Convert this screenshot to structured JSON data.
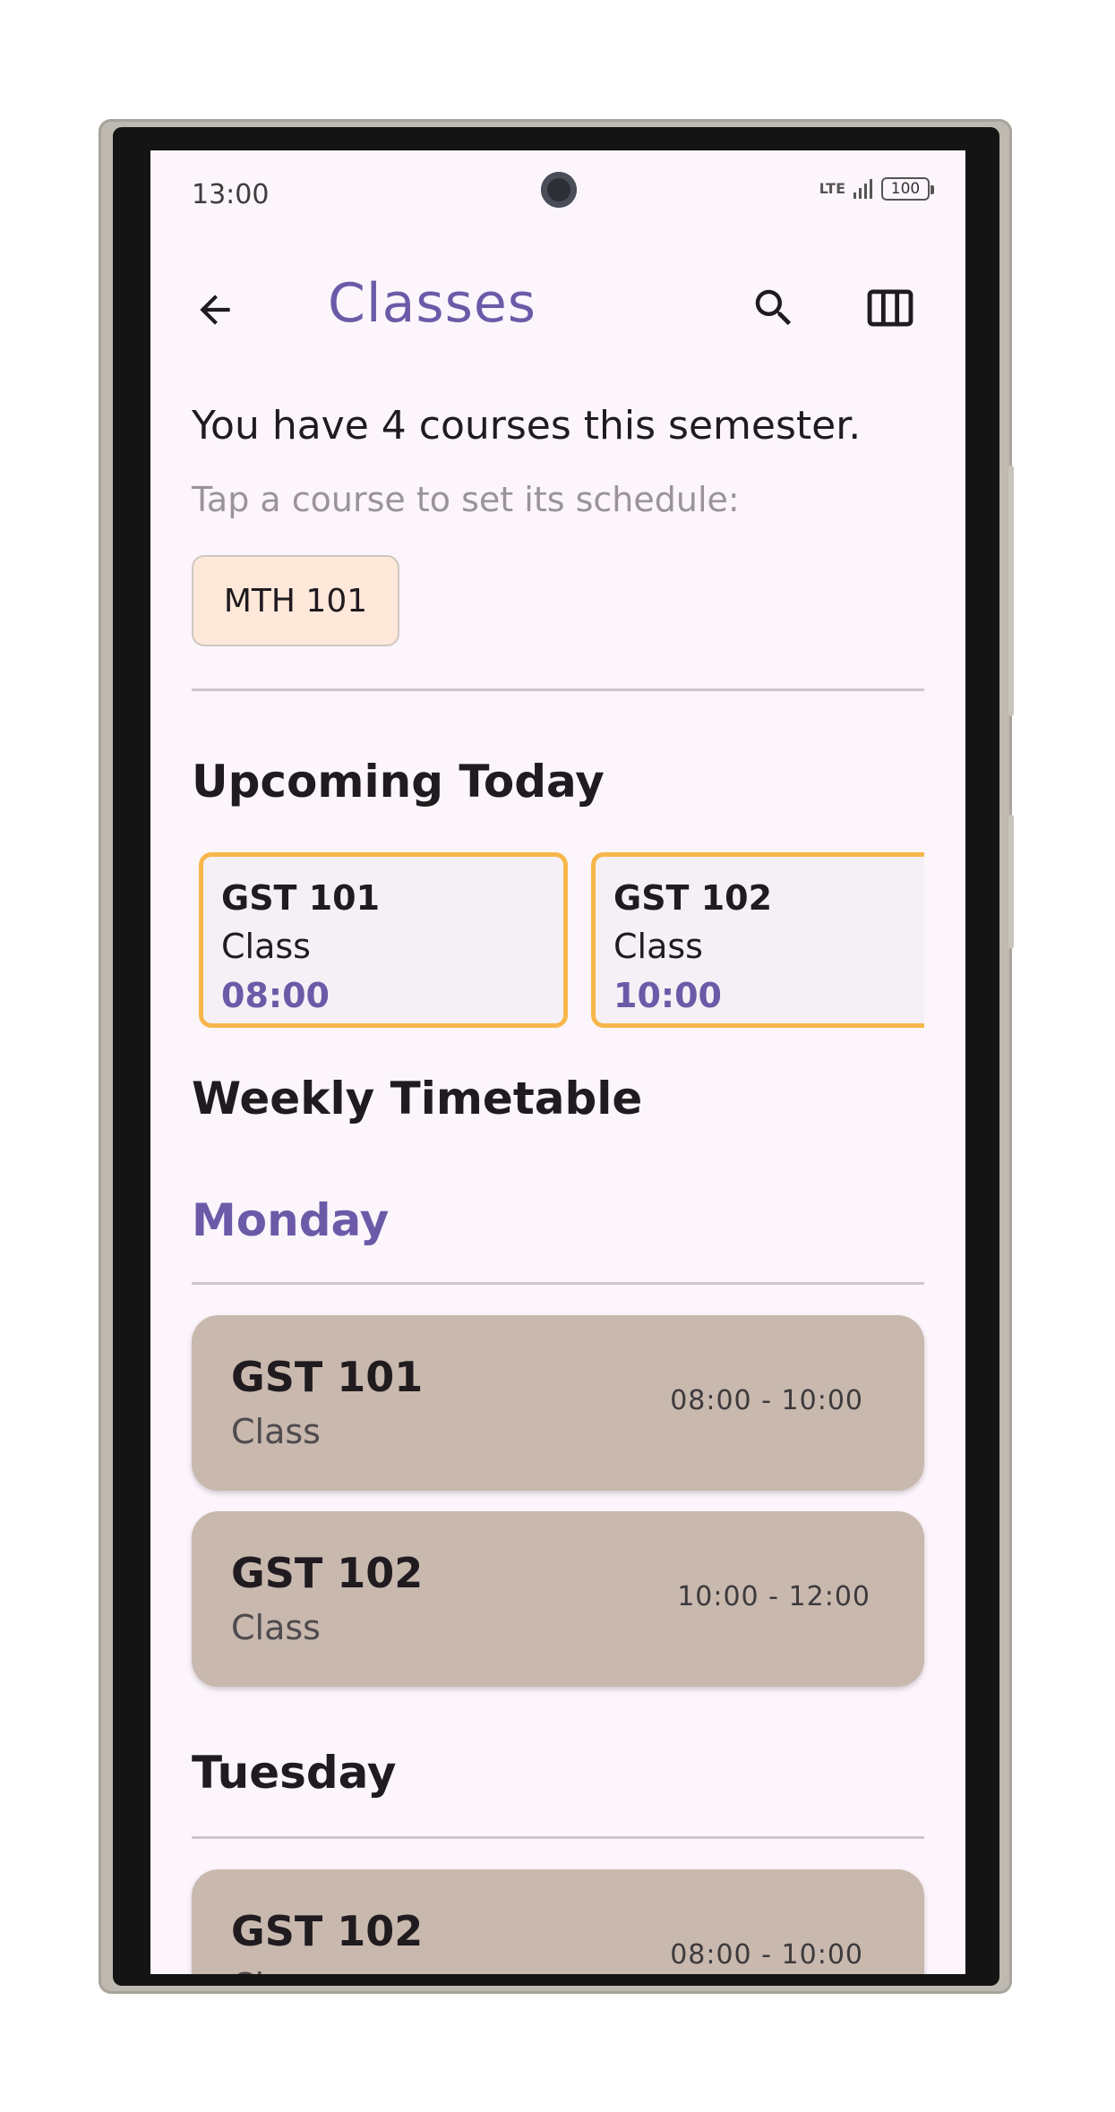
{
  "status_bar": {
    "time": "13:00",
    "network": "LTE",
    "battery": "100"
  },
  "app_bar": {
    "title": "Classes",
    "icons": [
      "back-arrow-icon",
      "search-icon",
      "view-columns-icon"
    ]
  },
  "summary": "You have 4 courses this semester.",
  "hint": "Tap a course to set its schedule:",
  "courses": [
    "MTH 101"
  ],
  "upcoming": {
    "title": "Upcoming Today",
    "items": [
      {
        "code": "GST 101",
        "type": "Class",
        "time": "08:00"
      },
      {
        "code": "GST 102",
        "type": "Class",
        "time": "10:00"
      }
    ]
  },
  "weekly": {
    "title": "Weekly Timetable",
    "days": [
      {
        "name": "Monday",
        "color": "#6c5aa8",
        "classes": [
          {
            "code": "GST 101",
            "type": "Class",
            "time": "08:00 - 10:00"
          },
          {
            "code": "GST 102",
            "type": "Class",
            "time": "10:00 - 12:00"
          }
        ]
      },
      {
        "name": "Tuesday",
        "color": "#1f1b1f",
        "classes": [
          {
            "code": "GST 102",
            "type": "Class",
            "time": "08:00 - 10:00"
          }
        ]
      }
    ]
  },
  "colors": {
    "accent": "#6c5aa8",
    "upcoming_border": "#f7b64c",
    "timetable_card": "#c8b8ad",
    "course_chip": "#fde8da",
    "background": "#fcf5fb"
  }
}
